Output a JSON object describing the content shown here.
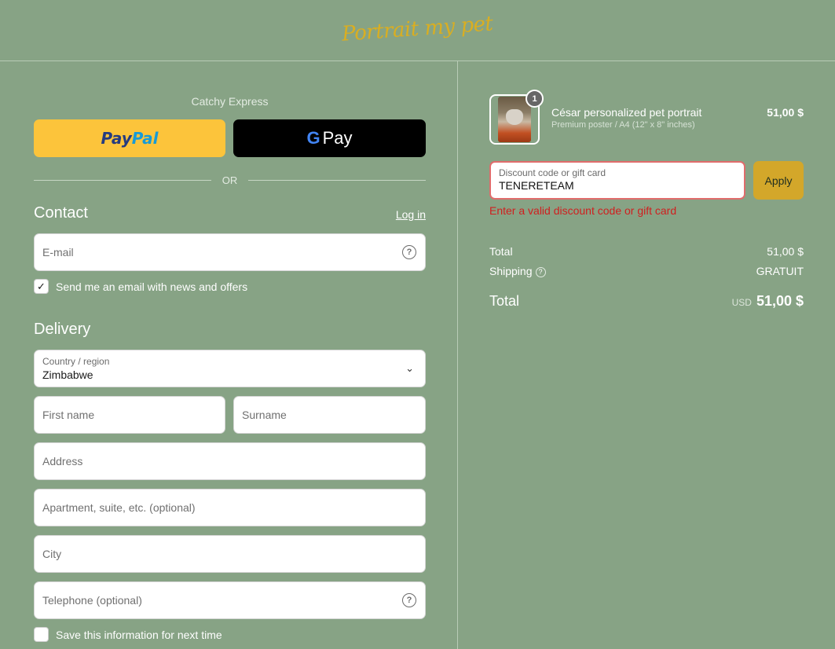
{
  "header": {
    "logo_text": "Portrait my pet"
  },
  "express": {
    "label": "Catchy Express",
    "paypal_part1": "Pay",
    "paypal_part2": "Pal",
    "gpay_g": "G",
    "gpay_text": "Pay",
    "or_text": "OR"
  },
  "contact": {
    "title": "Contact",
    "login_link": "Log in",
    "email_placeholder": "E-mail",
    "newsletter_label": "Send me an email with news and offers",
    "newsletter_checked": true
  },
  "delivery": {
    "title": "Delivery",
    "country_label": "Country / region",
    "country_value": "Zimbabwe",
    "first_name_placeholder": "First name",
    "surname_placeholder": "Surname",
    "address_placeholder": "Address",
    "apartment_placeholder": "Apartment, suite, etc. (optional)",
    "city_placeholder": "City",
    "telephone_placeholder": "Telephone (optional)",
    "save_info_label": "Save this information for next time",
    "save_info_checked": false
  },
  "order": {
    "item": {
      "quantity": "1",
      "name": "César personalized pet portrait",
      "variant": "Premium poster / A4 (12\" x 8\" inches)",
      "price": "51,00 $"
    },
    "discount": {
      "label": "Discount code or gift card",
      "value": "TENERETEAM",
      "apply_label": "Apply",
      "error": "Enter a valid discount code or gift card"
    },
    "summary": {
      "subtotal_label": "Total",
      "subtotal_value": "51,00 $",
      "shipping_label": "Shipping",
      "shipping_value": "GRATUIT",
      "total_label": "Total",
      "currency": "USD",
      "total_value": "51,00 $"
    }
  },
  "colors": {
    "background": "#87a385",
    "paypal_button": "#fcc43b",
    "apply_button": "#d3a72a",
    "error": "#d01f1f",
    "logo": "#d9ae22"
  }
}
